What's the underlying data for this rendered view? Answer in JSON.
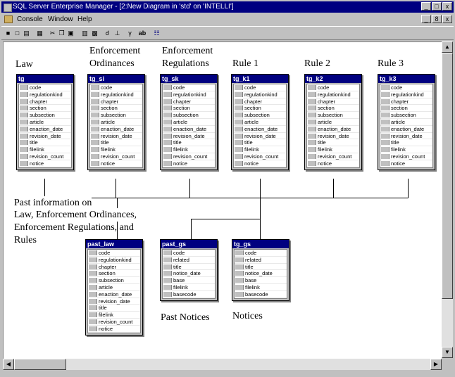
{
  "window": {
    "title": "SQL Server Enterprise Manager - [2:New Diagram in 'std' on 'INTELLI']",
    "buttons": [
      "_",
      "□",
      "x"
    ],
    "mdi_buttons": [
      "_",
      "8",
      "x"
    ]
  },
  "menu": {
    "items": [
      "Console",
      "Window",
      "Help"
    ]
  },
  "toolbar": {
    "icons": [
      "save-icon",
      "new-icon",
      "print-icon",
      "copy-table-icon",
      "cut-icon",
      "copy-icon",
      "paste-icon",
      "add-table-icon",
      "layout-icon",
      "zoom-icon",
      "relationship-icon",
      "index-icon",
      "text-annotation-icon",
      "diagram-icon"
    ],
    "annotation_label": "ab"
  },
  "labels": {
    "law": "Law",
    "enf_ord_1": "Enforcement",
    "enf_ord_2": "Ordinances",
    "enf_reg_1": "Enforcement",
    "enf_reg_2": "Regulations",
    "rule1": "Rule 1",
    "rule2": "Rule 2",
    "rule3": "Rule 3",
    "past_info_1": "Past information on",
    "past_info_2": "Law, Enforcement Ordinances,",
    "past_info_3": "Enforcement Regulations, and",
    "past_info_4": "Rules",
    "past_notices": "Past Notices",
    "notices": "Notices"
  },
  "tables": [
    {
      "name": "tg",
      "columns": [
        "code",
        "regulationkind",
        "chapter",
        "section",
        "subsection",
        "article",
        "enaction_date",
        "revision_date",
        "title",
        "filelink",
        "revision_count",
        "notice"
      ]
    },
    {
      "name": "tg_si",
      "columns": [
        "code",
        "regulationkind",
        "chapter",
        "section",
        "subsection",
        "article",
        "enaction_date",
        "revision_date",
        "title",
        "filelink",
        "revision_count",
        "notice"
      ]
    },
    {
      "name": "tg_sk",
      "columns": [
        "code",
        "regulationkind",
        "chapter",
        "section",
        "subsection",
        "article",
        "enaction_date",
        "revision_date",
        "title",
        "filelink",
        "revision_count",
        "notice"
      ]
    },
    {
      "name": "tg_k1",
      "columns": [
        "code",
        "regulationkind",
        "chapter",
        "section",
        "subsection",
        "article",
        "enaction_date",
        "revision_date",
        "title",
        "filelink",
        "revision_count",
        "notice"
      ]
    },
    {
      "name": "tg_k2",
      "columns": [
        "code",
        "regulationkind",
        "chapter",
        "section",
        "subsection",
        "article",
        "enaction_date",
        "revision_date",
        "title",
        "filelink",
        "revision_count",
        "notice"
      ]
    },
    {
      "name": "tg_k3",
      "columns": [
        "code",
        "regulationkind",
        "chapter",
        "section",
        "subsection",
        "article",
        "enaction_date",
        "revision_date",
        "title",
        "filelink",
        "revision_count",
        "notice"
      ]
    },
    {
      "name": "past_law",
      "columns": [
        "code",
        "regulationkind",
        "chapter",
        "section",
        "subsection",
        "article",
        "enaction_date",
        "revision_date",
        "title",
        "filelink",
        "revision_count",
        "notice"
      ]
    },
    {
      "name": "past_gs",
      "columns": [
        "code",
        "related",
        "title",
        "notice_date",
        "base",
        "filelink",
        "basecode"
      ]
    },
    {
      "name": "tg_gs",
      "columns": [
        "code",
        "related",
        "title",
        "notice_date",
        "base",
        "filelink",
        "basecode"
      ]
    }
  ]
}
